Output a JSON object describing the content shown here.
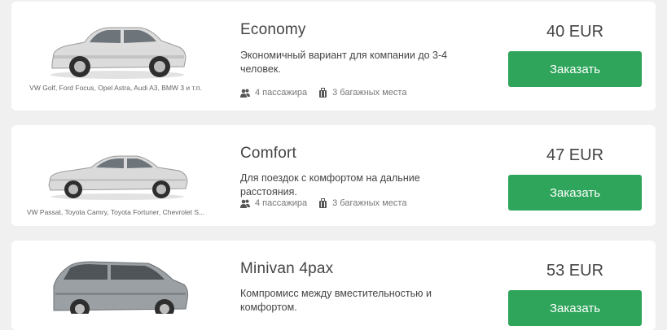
{
  "colors": {
    "background": "#f0f0f0",
    "card": "#ffffff",
    "button": "#2ea55a"
  },
  "cars": [
    {
      "title": "Economy",
      "description": "Экономичный вариант для компании до 3-4 человек.",
      "models": "VW Golf, Ford Focus, Opel Astra, Audi A3, BMW 3 и т.п.",
      "passengers": "4 пассажира",
      "luggage": "3 багажных места",
      "price": "40 EUR",
      "order_label": "Заказать",
      "car_icon": "hatchback-car-image"
    },
    {
      "title": "Comfort",
      "description": "Для поездок с комфортом на дальние расстояния.",
      "models": "VW Passat, Toyota Camry, Toyota Fortuner, Chevrolet S...",
      "passengers": "4 пассажира",
      "luggage": "3 багажных места",
      "price": "47 EUR",
      "order_label": "Заказать",
      "car_icon": "sedan-car-image"
    },
    {
      "title": "Minivan 4pax",
      "description": "Компромисс между вместительностью и комфортом.",
      "price": "53 EUR",
      "order_label": "Заказать",
      "car_icon": "minivan-car-image"
    }
  ]
}
